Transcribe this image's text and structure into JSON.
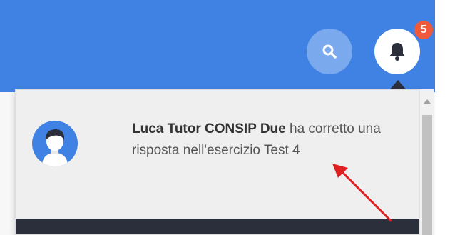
{
  "header": {
    "badge_count": "5",
    "colors": {
      "topbar": "#3f82e4",
      "badge": "#ef5a3a",
      "search_button": "#7ba9ee"
    },
    "icons": {
      "search": "search-icon",
      "notifications": "bell-icon"
    }
  },
  "notifications": {
    "items": [
      {
        "actor": "Luca Tutor CONSIP Due",
        "message": " ha corretto una risposta nell'esercizio Test 4",
        "avatar_icon": "user-avatar-icon"
      }
    ]
  },
  "annotation": {
    "arrow_color": "#e02020"
  }
}
